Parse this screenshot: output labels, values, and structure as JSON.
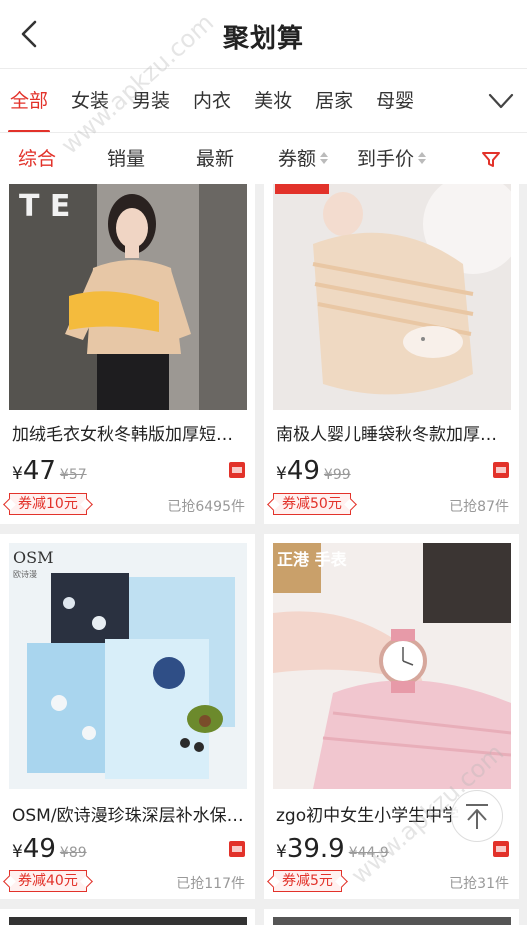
{
  "header": {
    "title": "聚划算",
    "back_icon": "chevron-left-icon"
  },
  "categories": {
    "items": [
      "全部",
      "女装",
      "男装",
      "内衣",
      "美妆",
      "居家",
      "母婴"
    ],
    "active_index": 0,
    "more_icon": "chevron-down-icon"
  },
  "sort": {
    "items": [
      "综合",
      "销量",
      "最新",
      "券额",
      "到手价"
    ],
    "active_index": 0,
    "filter_icon": "filter-icon"
  },
  "products": [
    {
      "name": "加绒毛衣女秋冬韩版加厚短…",
      "currency": "¥",
      "price": "47",
      "old_price": "¥57",
      "coupon": "券减10元",
      "sold": "已抢6495件",
      "platform_icon": "tmall-icon"
    },
    {
      "name": "南极人婴儿睡袋秋冬款加厚…",
      "currency": "¥",
      "price": "49",
      "old_price": "¥99",
      "coupon": "券减50元",
      "sold": "已抢87件",
      "platform_icon": "tmall-icon"
    },
    {
      "name": "OSM/欧诗漫珍珠深层补水保…",
      "currency": "¥",
      "price": "49",
      "old_price": "¥89",
      "coupon": "券减40元",
      "sold": "已抢117件",
      "platform_icon": "tmall-icon"
    },
    {
      "name": "zgo初中女生小学生中学",
      "currency": "¥",
      "price": "39.9",
      "old_price": "¥44.9",
      "coupon": "券减5元",
      "sold": "已抢31件",
      "platform_icon": "tmall-icon"
    }
  ],
  "image_text": {
    "sweater_sign": "T E",
    "osm_logo": "OSM",
    "osm_sub": "欧诗漫",
    "watch_badge": "正港 手表"
  },
  "watermark": "www.apkzu.com",
  "to_top_icon": "arrow-up-icon",
  "colors": {
    "accent": "#e2322a",
    "text": "#222222",
    "muted": "#999999",
    "background": "#efefef"
  }
}
